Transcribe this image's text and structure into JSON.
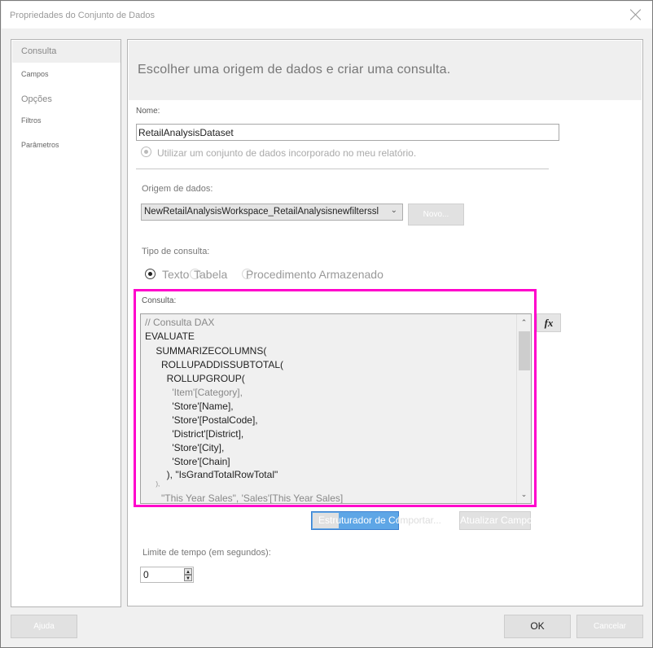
{
  "window": {
    "title": "Propriedades do Conjunto de Dados",
    "close_icon": "close-icon"
  },
  "sidebar": {
    "items": [
      {
        "label": "Consulta",
        "active": true
      },
      {
        "label": "Campos",
        "active": false
      },
      {
        "label": "Opções",
        "active": false
      },
      {
        "label": "Filtros",
        "active": false
      },
      {
        "label": "Parâmetros",
        "active": false
      }
    ]
  },
  "main": {
    "header": "Escolher uma origem de dados e criar uma consulta.",
    "name_label": "Nome:",
    "name_value": "RetailAnalysisDataset",
    "embedded_option": "Utilizar um conjunto de dados incorporado no meu relatório.",
    "datasource_label": "Origem de dados:",
    "datasource_value": "NewRetailAnalysisWorkspace_RetailAnalysisnewfilterssl",
    "new_button": "Novo...",
    "query_type_label": "Tipo de consulta:",
    "query_types": [
      {
        "label": "Texto",
        "selected": true
      },
      {
        "label": "Tabela",
        "selected": false
      },
      {
        "label": "Procedimento Armazenado",
        "selected": false
      }
    ],
    "query_label": "Consulta:",
    "query_lines": [
      "// Consulta DAX",
      "EVALUATE",
      "    SUMMARIZECOLUMNS(",
      "      ROLLUPADDISSUBTOTAL(",
      "        ROLLUPGROUP(",
      "          'Item'[Category],",
      "          'Store'[Name],",
      "          'Store'[PostalCode],",
      "          'District'[District],",
      "          'Store'[City],",
      "          'Store'[Chain]",
      "        ), \"IsGrandTotalRowTotal\"",
      "      ),",
      "      \"This Year Sales\", 'Sales'[This Year Sales]"
    ],
    "fx_button": "fx",
    "query_designer_button": "Estruturador de Consultas...",
    "import_button": "Importar...",
    "refresh_fields_button": "Atualizar Campos",
    "timeout_label": "Limite de tempo (em segundos):",
    "timeout_value": "0"
  },
  "footer": {
    "help_button": "Ajuda",
    "ok_button": "OK",
    "cancel_button": "Cancelar"
  },
  "colors": {
    "highlight": "#ff00cc",
    "primary_button": "#5ea6e6"
  }
}
